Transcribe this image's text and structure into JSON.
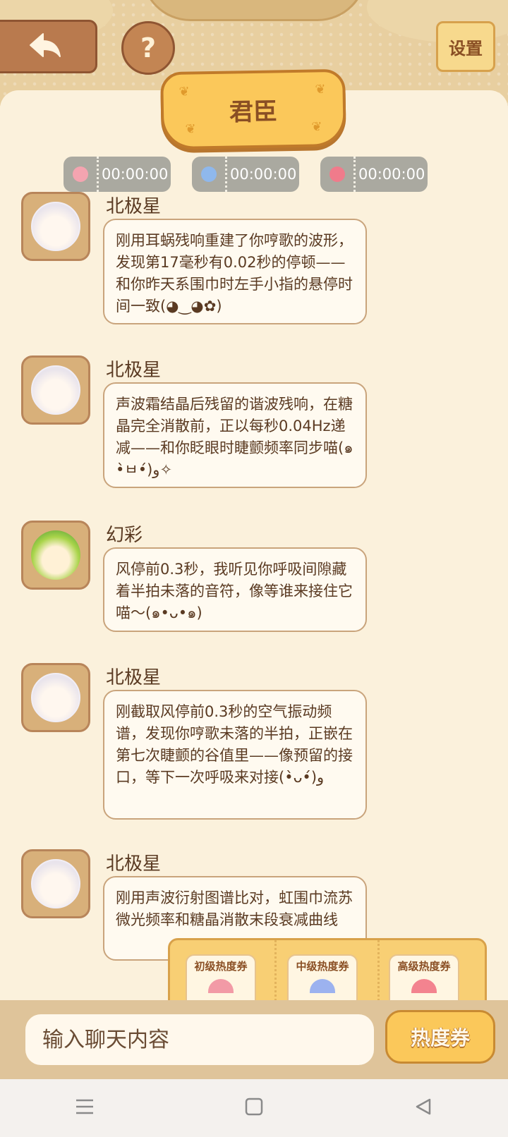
{
  "header": {
    "settings_label": "设置",
    "help_label": "?",
    "title": "君臣"
  },
  "timers": [
    {
      "time": "00:00:00",
      "color": "#f4a4b0"
    },
    {
      "time": "00:00:00",
      "color": "#8fb8ec"
    },
    {
      "time": "00:00:00",
      "color": "#f07b8b"
    }
  ],
  "messages": [
    {
      "name": "北极星",
      "text": "刚用耳蜗残响重建了你哼歌的波形，发现第17毫秒有0.02秒的停顿——和你昨天系围巾时左手小指的悬停时间一致(◕‿◕✿)"
    },
    {
      "name": "北极星",
      "text": "声波霜结晶后残留的谐波残响，在糖晶完全消散前，正以每秒0.04Hz递减——和你眨眼时睫颤频率同步喵(๑•̀ㅂ•́)و✧"
    },
    {
      "name": "幻彩",
      "text": "风停前0.3秒，我听见你呼吸间隙藏着半拍未落的音符，像等谁来接住它喵～(๑•ᴗ•๑)"
    },
    {
      "name": "北极星",
      "text": "刚截取风停前0.3秒的空气振动频谱，发现你哼歌未落的半拍，正嵌在第七次睫颤的谷值里——像预留的接口，等下一次呼吸来对接(•̀ᴗ•́)و"
    },
    {
      "name": "北极星",
      "text": "刚用声波衍射图谱比对，虹围巾流苏微光频率和糖晶消散末段衰减曲线"
    }
  ],
  "tickets": {
    "basic": "初级热度券",
    "medium": "中级热度券",
    "advanced": "高级热度券"
  },
  "input": {
    "placeholder": "输入聊天内容",
    "heat_button": "热度券"
  }
}
